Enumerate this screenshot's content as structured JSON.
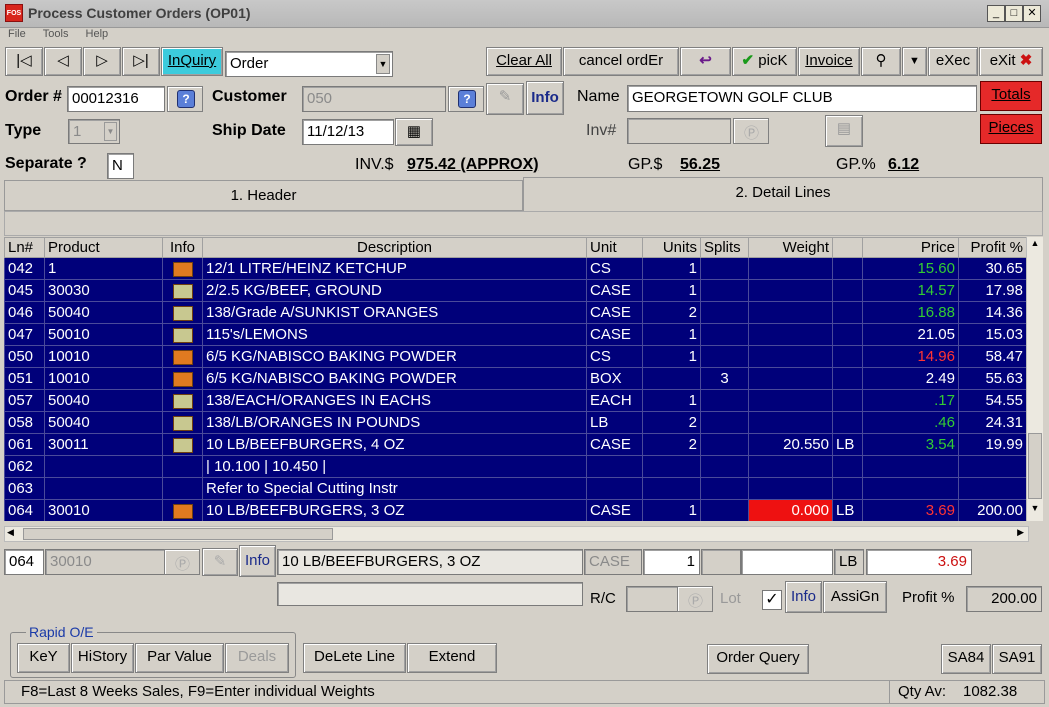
{
  "window": {
    "title": "Process Customer Orders  (OP01)",
    "icon_text": "FOS"
  },
  "menu": [
    "File",
    "Tools",
    "Help"
  ],
  "toolbar": {
    "inquiry": "InQuiry",
    "mode_select": "Order",
    "clear_all": "Clear All",
    "cancel_order": "cancel ordEr",
    "pick": "picK",
    "invoice": "Invoice",
    "exec": "eXec",
    "exit": "eXit"
  },
  "header": {
    "order_label": "Order #",
    "order_value": "00012316",
    "customer_label": "Customer",
    "customer_value": "050",
    "info": "Info",
    "name_label": "Name",
    "name_value": "GEORGETOWN GOLF CLUB",
    "totals": "Totals",
    "type_label": "Type",
    "type_value": "1",
    "ship_date_label": "Ship Date",
    "ship_date_value": "11/12/13",
    "inv_label": "Inv#",
    "inv_value": "",
    "pieces": "Pieces",
    "separate_label": "Separate ?",
    "separate_value": "N",
    "inv_dollar_label": "INV.$",
    "inv_dollar_value": "975.42 (APPROX)",
    "gp_dollar_label": "GP.$",
    "gp_dollar_value": "56.25",
    "gp_pct_label": "GP.%",
    "gp_pct_value": "6.12"
  },
  "tabs": [
    "1. Header",
    "2. Detail Lines"
  ],
  "grid": {
    "columns": [
      "Ln#",
      "Product",
      "Info",
      "Description",
      "Unit",
      "Units",
      "Splits",
      "Weight",
      "",
      "Price",
      "Profit %"
    ],
    "rows": [
      {
        "ln": "042",
        "product": "1",
        "info": "red",
        "desc": "12/1 LITRE/HEINZ KETCHUP",
        "unit": "CS",
        "units": "1",
        "splits": "",
        "weight": "",
        "wu": "",
        "price": "15.60",
        "price_color": "#33cc33",
        "profit": "30.65"
      },
      {
        "ln": "045",
        "product": "30030",
        "info": "tan",
        "desc": "2/2.5 KG/BEEF, GROUND",
        "unit": "CASE",
        "units": "1",
        "splits": "",
        "weight": "",
        "wu": "",
        "price": "14.57",
        "price_color": "#33cc33",
        "profit": "17.98"
      },
      {
        "ln": "046",
        "product": "50040",
        "info": "tan",
        "desc": "138/Grade A/SUNKIST ORANGES",
        "unit": "CASE",
        "units": "2",
        "splits": "",
        "weight": "",
        "wu": "",
        "price": "16.88",
        "price_color": "#33cc33",
        "profit": "14.36"
      },
      {
        "ln": "047",
        "product": "50010",
        "info": "tan",
        "desc": "115's/LEMONS",
        "unit": "CASE",
        "units": "1",
        "splits": "",
        "weight": "",
        "wu": "",
        "price": "21.05",
        "price_color": "#ffffff",
        "profit": "15.03"
      },
      {
        "ln": "050",
        "product": "10010",
        "info": "red",
        "desc": "6/5 KG/NABISCO BAKING POWDER",
        "unit": "CS",
        "units": "1",
        "splits": "",
        "weight": "",
        "wu": "",
        "price": "14.96",
        "price_color": "#ff3333",
        "profit": "58.47"
      },
      {
        "ln": "051",
        "product": "10010",
        "info": "red",
        "desc": "6/5 KG/NABISCO BAKING POWDER",
        "unit": "BOX",
        "units": "",
        "splits": "3",
        "weight": "",
        "wu": "",
        "price": "2.49",
        "price_color": "#ffffff",
        "profit": "55.63"
      },
      {
        "ln": "057",
        "product": "50040",
        "info": "tan",
        "desc": "138/EACH/ORANGES IN EACHS",
        "unit": "EACH",
        "units": "1",
        "splits": "",
        "weight": "",
        "wu": "",
        "price": ".17",
        "price_color": "#33cc33",
        "profit": "54.55"
      },
      {
        "ln": "058",
        "product": "50040",
        "info": "tan",
        "desc": "138/LB/ORANGES IN POUNDS",
        "unit": "LB",
        "units": "2",
        "splits": "",
        "weight": "",
        "wu": "",
        "price": ".46",
        "price_color": "#33cc33",
        "profit": "24.31"
      },
      {
        "ln": "061",
        "product": "30011",
        "info": "tan",
        "desc": "10 LB/BEEFBURGERS, 4 OZ",
        "unit": "CASE",
        "units": "2",
        "splits": "",
        "weight": "20.550",
        "wu": "LB",
        "price": "3.54",
        "price_color": "#33cc33",
        "profit": "19.99"
      },
      {
        "ln": "062",
        "product": "",
        "info": "",
        "desc": "| 10.100 |  10.450 |",
        "unit": "",
        "units": "",
        "splits": "",
        "weight": "",
        "wu": "",
        "price": "",
        "price_color": "#ffffff",
        "profit": ""
      },
      {
        "ln": "063",
        "product": "",
        "info": "",
        "desc": "Refer to Special Cutting Instr",
        "unit": "",
        "units": "",
        "splits": "",
        "weight": "",
        "wu": "",
        "price": "",
        "price_color": "#ffffff",
        "profit": ""
      },
      {
        "ln": "064",
        "product": "30010",
        "info": "red",
        "desc": "10 LB/BEEFBURGERS, 3 OZ",
        "unit": "CASE",
        "units": "1",
        "splits": "",
        "weight": "0.000",
        "wu": "LB",
        "price": "3.69",
        "price_color": "#ff3333",
        "profit": "200.00"
      }
    ]
  },
  "edit": {
    "ln": "064",
    "product": "30010",
    "info": "Info",
    "desc": "10 LB/BEEFBURGERS, 3 OZ",
    "unit": "CASE",
    "units": "1",
    "weight_unit": "LB",
    "price": "3.69",
    "rc_label": "R/C",
    "lot_label": "Lot",
    "info2": "Info",
    "assign": "AssiGn",
    "profit_label": "Profit %",
    "profit_value": "200.00"
  },
  "bottom": {
    "group_label": "Rapid O/E",
    "key": "KeY",
    "history": "HiStory",
    "par_value": "Par Value",
    "deals": "Deals",
    "delete_line": "DeLete Line",
    "extend": "Extend",
    "order_query": "Order Query",
    "sa84": "SA84",
    "sa91": "SA91"
  },
  "status": {
    "hint": "F8=Last 8 Weeks Sales,   F9=Enter individual Weights",
    "qty_label": "Qty Av:",
    "qty_value": "1082.38"
  }
}
